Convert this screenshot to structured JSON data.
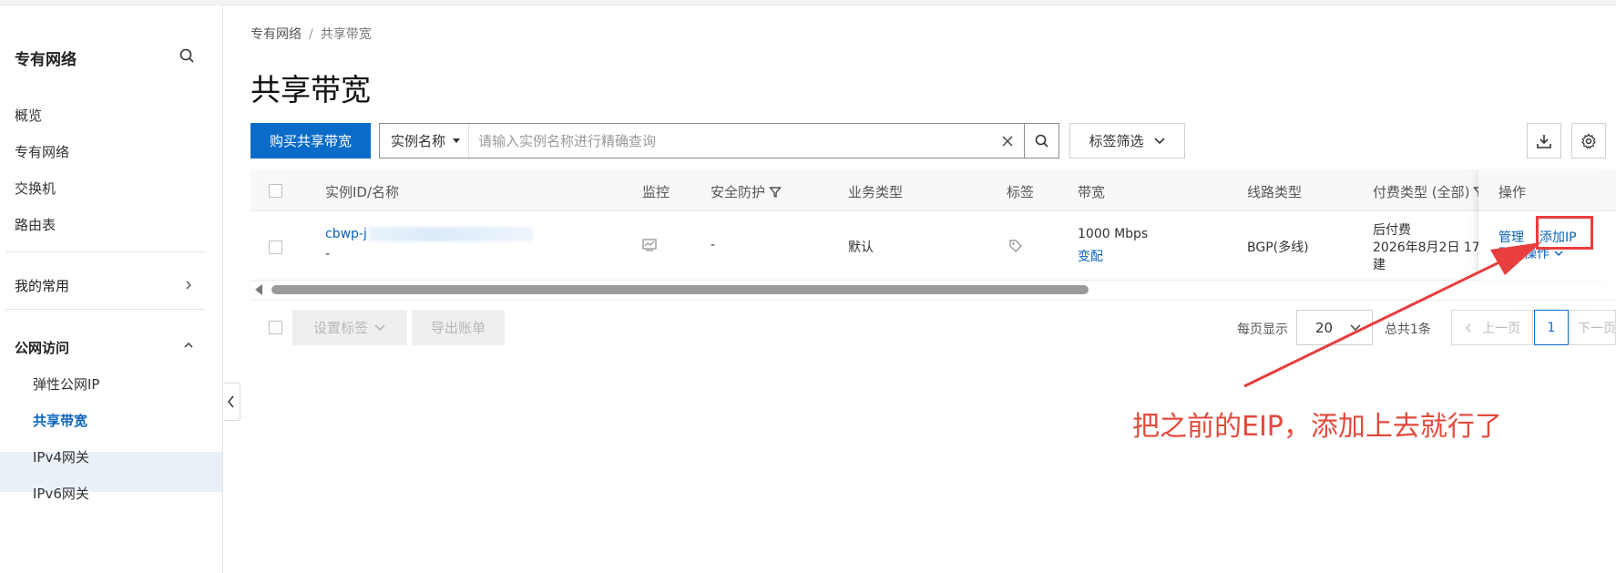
{
  "sidebar": {
    "title": "专有网络",
    "items": [
      {
        "label": "概览"
      },
      {
        "label": "专有网络"
      },
      {
        "label": "交换机"
      },
      {
        "label": "路由表"
      }
    ],
    "my_common": "我的常用",
    "public_access": "公网访问",
    "sub_items": [
      {
        "label": "弹性公网IP"
      },
      {
        "label": "共享带宽"
      },
      {
        "label": "IPv4网关"
      },
      {
        "label": "IPv6网关"
      }
    ]
  },
  "breadcrumb": {
    "parent": "专有网络",
    "sep": "/",
    "current": "共享带宽"
  },
  "page_title": "共享带宽",
  "toolbar": {
    "buy_label": "购买共享带宽",
    "search_field": "实例名称",
    "search_placeholder": "请输入实例名称进行精确查询",
    "tag_filter": "标签筛选"
  },
  "table": {
    "headers": {
      "id_name": "实例ID/名称",
      "monitor": "监控",
      "security": "安全防护",
      "biz_type": "业务类型",
      "tags": "标签",
      "bandwidth": "带宽",
      "line_type": "线路类型",
      "pay_type": "付费类型 (全部)",
      "ops": "操作"
    },
    "rows": [
      {
        "id_prefix": "cbwp-j",
        "name": "-",
        "security": "-",
        "biz_type": "默认",
        "bandwidth": "1000 Mbps",
        "bandwidth_action": "变配",
        "line_type": "BGP(多线)",
        "pay_type": "后付费",
        "pay_date": "2026年8月2日 17:",
        "pay_date_suffix": "建",
        "op_manage": "管理",
        "op_add_ip": "添加IP",
        "op_more": "更多操作"
      }
    ]
  },
  "footer": {
    "set_tags": "设置标签",
    "export_bill": "导出账单",
    "per_page_label": "每页显示",
    "per_page_value": "20",
    "total": "总共1条",
    "prev": "上一页",
    "current_page": "1",
    "next": "下一页"
  },
  "annotation": {
    "text": "把之前的EIP，添加上去就行了",
    "color": "#e24a3b"
  },
  "colors": {
    "primary": "#0b6bc8",
    "link": "#0b63bd",
    "highlight": "#e83e3e"
  }
}
